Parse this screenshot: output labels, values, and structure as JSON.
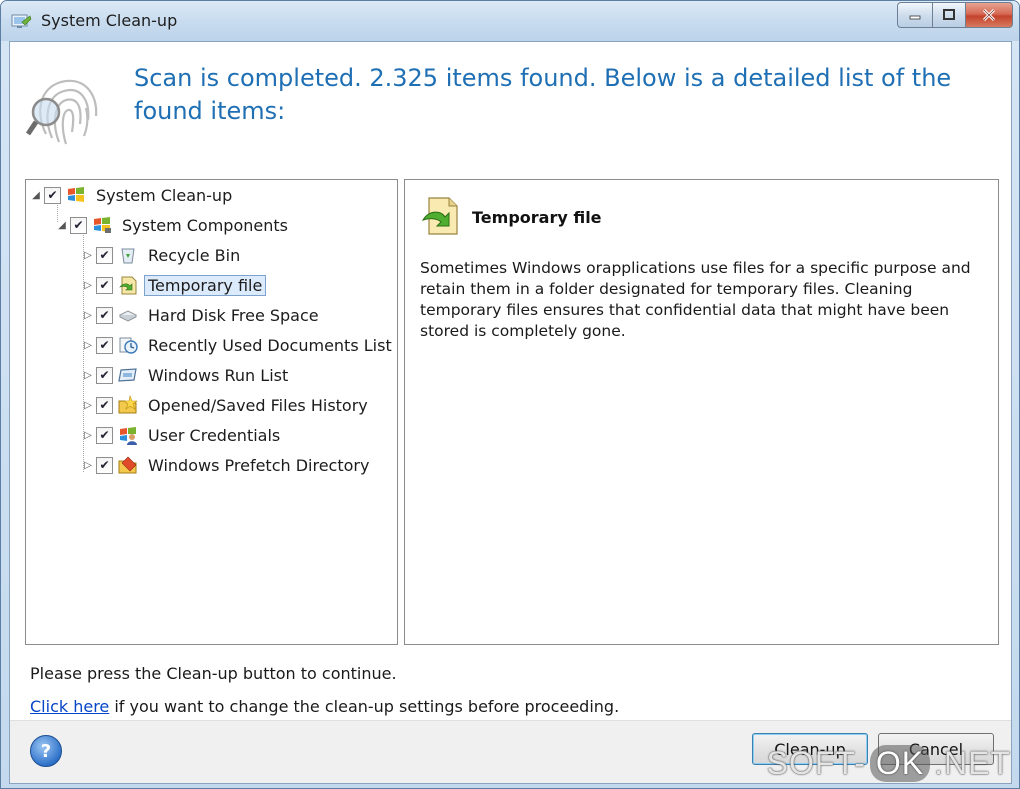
{
  "window": {
    "title": "System Clean-up"
  },
  "header": {
    "message": "Scan is completed. 2.325 items found. Below is a detailed list of the found items:"
  },
  "tree": {
    "root": "System Clean-up",
    "group": "System Components",
    "items": [
      {
        "label": "Recycle Bin",
        "icon": "recycle-bin-icon",
        "checked": true
      },
      {
        "label": "Temporary file",
        "icon": "temporary-file-icon",
        "checked": true,
        "selected": true
      },
      {
        "label": "Hard Disk Free Space",
        "icon": "hard-disk-icon",
        "checked": true
      },
      {
        "label": "Recently Used Documents List",
        "icon": "recent-documents-icon",
        "checked": true
      },
      {
        "label": "Windows Run List",
        "icon": "run-list-icon",
        "checked": true
      },
      {
        "label": "Opened/Saved Files History",
        "icon": "folder-history-icon",
        "checked": true
      },
      {
        "label": "User Credentials",
        "icon": "user-credentials-icon",
        "checked": true
      },
      {
        "label": "Windows Prefetch Directory",
        "icon": "prefetch-directory-icon",
        "checked": true
      }
    ]
  },
  "detail": {
    "title": "Temporary file",
    "description": "Sometimes Windows orapplications use files for a specific purpose and retain them in a folder designated for temporary files. Cleaning temporary files ensures that confidential data that might have been stored is completely gone."
  },
  "footer_text": {
    "hint": "Please press the Clean-up button to continue.",
    "link": "Click here",
    "link_suffix": " if you want to change the clean-up settings before proceeding."
  },
  "buttons": {
    "cleanup": "Clean-up",
    "cancel": "Cancel",
    "help": "?"
  },
  "watermark": {
    "left": "SOFT-",
    "mid": "OK",
    "right": ".NET"
  },
  "colors": {
    "headline": "#1f6fb4",
    "link": "#0645c8",
    "selection": "#dcebfc"
  }
}
